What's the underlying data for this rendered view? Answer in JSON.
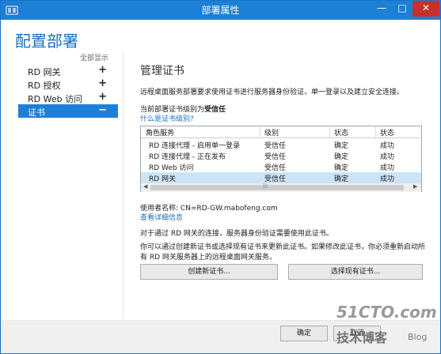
{
  "window": {
    "title": "部署属性"
  },
  "heading": "配置部署",
  "sidebar": {
    "show_all": "全部显示",
    "items": [
      {
        "label": "RD 网关",
        "toggle": "+"
      },
      {
        "label": "RD 授权",
        "toggle": "+"
      },
      {
        "label": "RD Web 访问",
        "toggle": "+"
      },
      {
        "label": "证书",
        "toggle": "−"
      }
    ]
  },
  "main": {
    "title": "管理证书",
    "description": "远程桌面服务部署要求使用证书进行服务器身份验证、单一登录以及建立安全连接。",
    "current_level_prefix": "当前部署证书级别为",
    "current_level_value": "受信任",
    "what_link": "什么是证书级别?",
    "grid": {
      "headers": [
        "角色服务",
        "级别",
        "状态",
        "状态"
      ],
      "rows": [
        [
          "RD 连接代理 - 启用单一登录",
          "受信任",
          "确定",
          "成功"
        ],
        [
          "RD 连接代理 - 正在发布",
          "受信任",
          "确定",
          "成功"
        ],
        [
          "RD Web 访问",
          "受信任",
          "确定",
          "成功"
        ],
        [
          "RD 网关",
          "受信任",
          "确定",
          "成功"
        ]
      ],
      "selected_row": 3
    },
    "cert_user": "使用者名称: CN=RD-GW.mabofeng.com",
    "details_link": "查看详细信息",
    "note1": "对于通过 RD 网关的连接，服务器身份验证需要使用此证书。",
    "note2": "你可以通过创建新证书或选择现有证书来更新此证书。如果修改此证书，你必须重新启动所有 RD 网关服务器上的远程桌面网关服务。",
    "btn_new": "创建新证书...",
    "btn_select": "选择现有证书..."
  },
  "footer": {
    "ok": "确定",
    "cancel": "取消"
  },
  "watermark": {
    "line1": "51CTO.com",
    "line2": "技术博客",
    "line3": "Blog"
  },
  "colors": {
    "accent": "#1b80d6",
    "close": "#c9302c",
    "link": "#1b6fc0"
  }
}
